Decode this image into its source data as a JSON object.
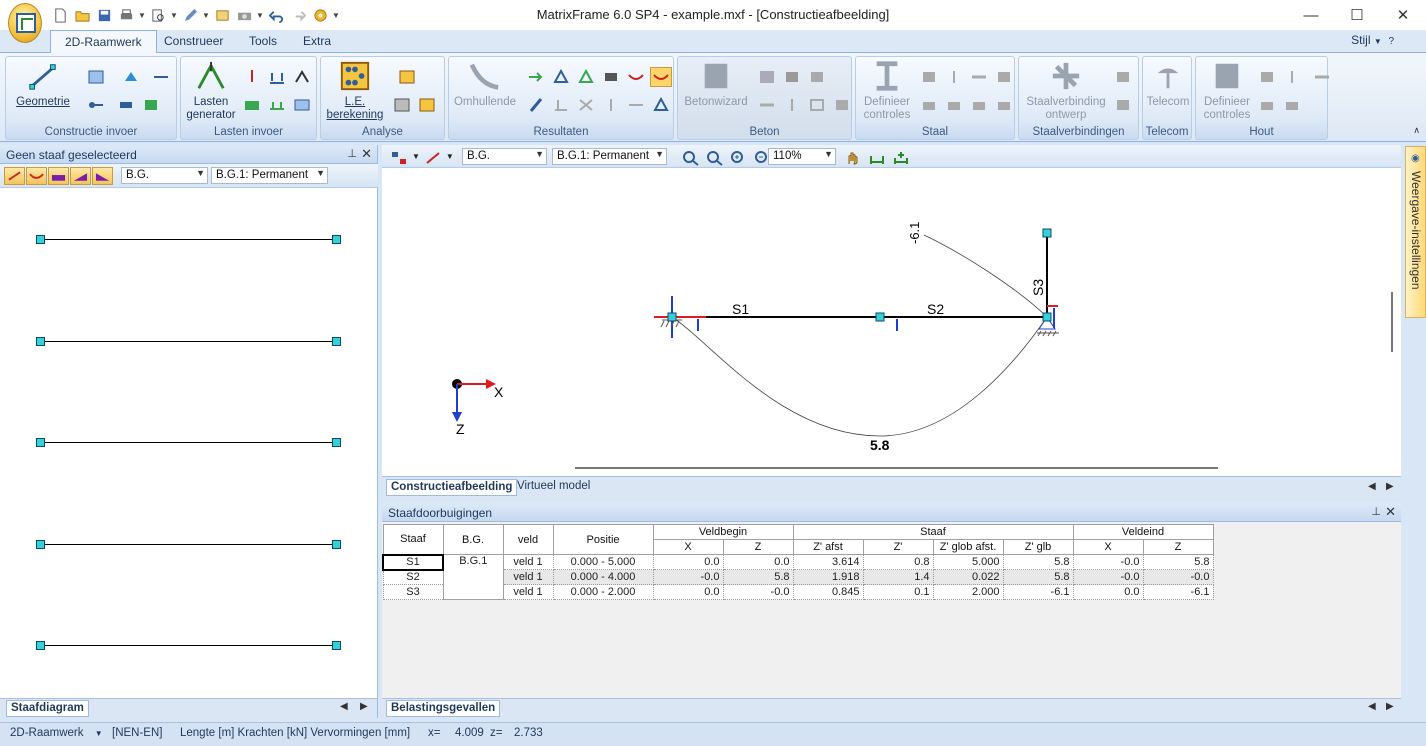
{
  "window": {
    "title": "MatrixFrame 6.0 SP4 - example.mxf - [Constructieafbeelding]",
    "minimize": "—",
    "maximize": "☐",
    "close": "✕"
  },
  "ribbon": {
    "tabs": [
      "2D-Raamwerk",
      "Construeer",
      "Tools",
      "Extra"
    ],
    "active_tab": "2D-Raamwerk",
    "style_label": "Stijl",
    "groups": {
      "constructie_invoer": {
        "label": "Constructie invoer",
        "geometrie": "Geometrie"
      },
      "lasten_invoer": {
        "label": "Lasten invoer",
        "lasten_generator": "Lasten generator"
      },
      "analyse": {
        "label": "Analyse",
        "le_berekening": "L.E. berekening"
      },
      "resultaten": {
        "label": "Resultaten",
        "omhullende": "Omhullende"
      },
      "beton": {
        "label": "Beton",
        "betonwizard": "Betonwizard"
      },
      "staal": {
        "label": "Staal",
        "definieer_controles": "Definieer controles"
      },
      "staalverbindingen": {
        "label": "Staalverbindingen",
        "staalverbinding_ontwerp": "Staalverbinding ontwerp"
      },
      "telecom": {
        "label": "Telecom",
        "telecom": "Telecom"
      },
      "hout": {
        "label": "Hout",
        "definieer_controles": "Definieer controles"
      }
    }
  },
  "left_panel": {
    "title": "Geen staaf geselecteerd",
    "combo_bg": "B.G.",
    "combo_case": "B.G.1: Permanent",
    "tab": "Staafdiagram"
  },
  "view": {
    "combo_bg": "B.G.",
    "combo_case": "B.G.1: Permanent",
    "zoom": "110%",
    "labels": {
      "s1": "S1",
      "s2": "S2",
      "s3": "S3",
      "max": "5.8",
      "min": "-6.1",
      "axis_x": "X",
      "axis_z": "Z"
    },
    "tabs": [
      "Constructieafbeelding",
      "Virtueel model"
    ],
    "side_tab": "Weergave-instellingen"
  },
  "table_panel": {
    "title": "Staafdoorbuigingen",
    "headers": {
      "staaf": "Staaf",
      "bg": "B.G.",
      "veld": "veld",
      "positie": "Positie",
      "veldbegin": "Veldbegin",
      "staaf_group": "Staaf",
      "veldeind": "Veldeind",
      "x": "X",
      "z": "Z",
      "z_afst": "Z' afst",
      "z_prime": "Z'",
      "z_glob_afst": "Z' glob afst.",
      "z_glb": "Z' glb"
    },
    "rows": [
      [
        "S1",
        "B.G.1",
        "veld 1",
        "0.000 - 5.000",
        "0.0",
        "0.0",
        "3.614",
        "0.8",
        "5.000",
        "5.8",
        "-0.0",
        "5.8"
      ],
      [
        "S2",
        "",
        "veld 1",
        "0.000 - 4.000",
        "-0.0",
        "5.8",
        "1.918",
        "1.4",
        "0.022",
        "5.8",
        "-0.0",
        "-0.0"
      ],
      [
        "S3",
        "",
        "veld 1",
        "0.000 - 2.000",
        "0.0",
        "-0.0",
        "0.845",
        "0.1",
        "2.000",
        "-6.1",
        "0.0",
        "-6.1"
      ]
    ],
    "tab": "Belastingsgevallen"
  },
  "status": {
    "mode": "2D-Raamwerk",
    "norm": "[NEN-EN]",
    "units": "Lengte [m] Krachten [kN] Vervormingen [mm]",
    "x_label": "x=",
    "x_value": "4.009",
    "z_label": "z=",
    "z_value": "2.733"
  },
  "colors": {
    "node": "#35d1d8",
    "accent": "#1e395b",
    "axis_x": "#e01b24",
    "axis_z": "#1c3fcf"
  }
}
